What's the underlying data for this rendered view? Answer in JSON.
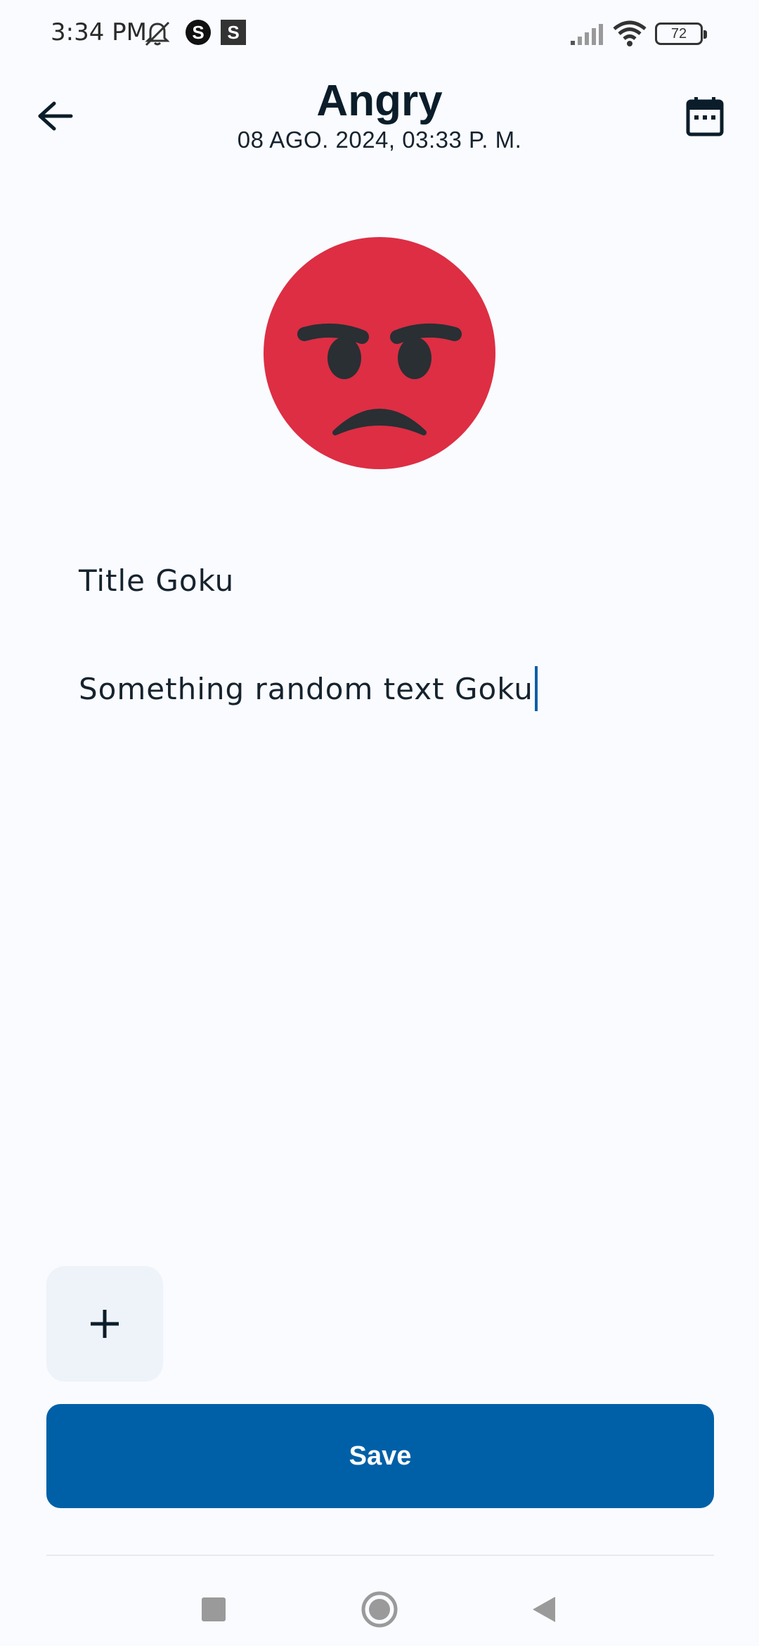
{
  "status_bar": {
    "time": "3:34 PM",
    "battery_level": "72",
    "icons": [
      "mute-bell-icon",
      "s-circle-icon",
      "s-square-icon",
      "signal-icon",
      "wifi-icon",
      "battery-icon"
    ],
    "s_label": "S"
  },
  "header": {
    "title": "Angry",
    "date": "08 AGO. 2024, 03:33 P. M.",
    "back_icon": "arrow-back-icon",
    "calendar_icon": "calendar-icon"
  },
  "mood": {
    "emoji": "angry-face",
    "face_color": "#DD2E44",
    "feature_color": "#292F33"
  },
  "entry": {
    "title_value": "Title Goku",
    "body_value": "Something random text Goku"
  },
  "actions": {
    "add_icon": "plus-icon",
    "save_label": "Save",
    "accent_color": "#0060A7"
  },
  "nav_bar": {
    "icons": [
      "recents-square-icon",
      "home-circle-icon",
      "back-triangle-icon"
    ]
  }
}
